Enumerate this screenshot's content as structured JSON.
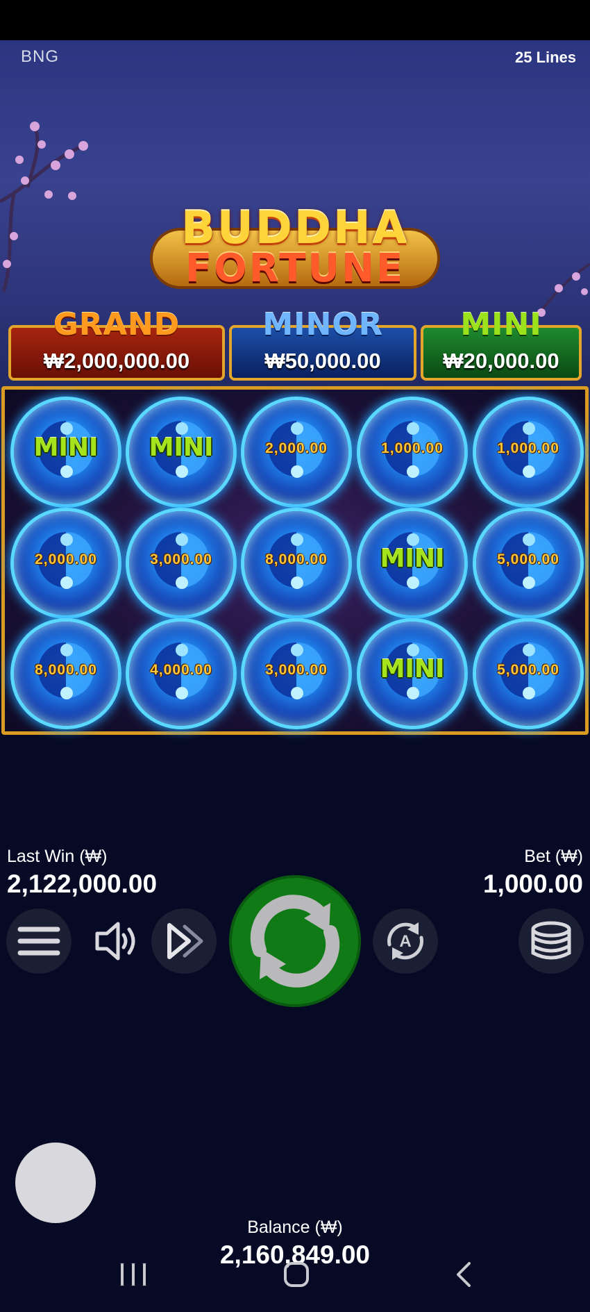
{
  "header": {
    "brand": "BNG",
    "lines": "25 Lines"
  },
  "logo": {
    "line1": "BUDDHA",
    "line2": "FORTUNE"
  },
  "jackpots": [
    {
      "title": "GRAND",
      "amount": "₩2,000,000.00"
    },
    {
      "title": "MINOR",
      "amount": "₩50,000.00"
    },
    {
      "title": "MINI",
      "amount": "₩20,000.00"
    }
  ],
  "reels": [
    [
      "MINI",
      "MINI",
      "2,000.00",
      "1,000.00",
      "1,000.00"
    ],
    [
      "2,000.00",
      "3,000.00",
      "8,000.00",
      "MINI",
      "5,000.00"
    ],
    [
      "8,000.00",
      "4,000.00",
      "3,000.00",
      "MINI",
      "5,000.00"
    ]
  ],
  "stats": {
    "last_win_label": "Last Win (₩)",
    "last_win_value": "2,122,000.00",
    "bet_label": "Bet (₩)",
    "bet_value": "1,000.00",
    "balance_label": "Balance (₩)",
    "balance_value": "2,160,849.00"
  },
  "controls": {
    "menu_icon": "hamburger-menu-icon",
    "sound_icon": "speaker-icon",
    "turbo_icon": "fast-forward-icon",
    "spin_icon": "spin-arrows-icon",
    "autoplay_icon": "autoplay-icon",
    "bet_icon": "coin-stack-icon",
    "autoplay_letter": "A"
  },
  "colors": {
    "spin_button": "#0f7a16",
    "grand_panel": "#a6250f",
    "minor_panel": "#1c4fa8",
    "mini_panel": "#1e8a2e",
    "frame_gold": "#d99b22",
    "coin_value_text": "#ffc83a",
    "mini_symbol_text": "#a5e41a"
  }
}
